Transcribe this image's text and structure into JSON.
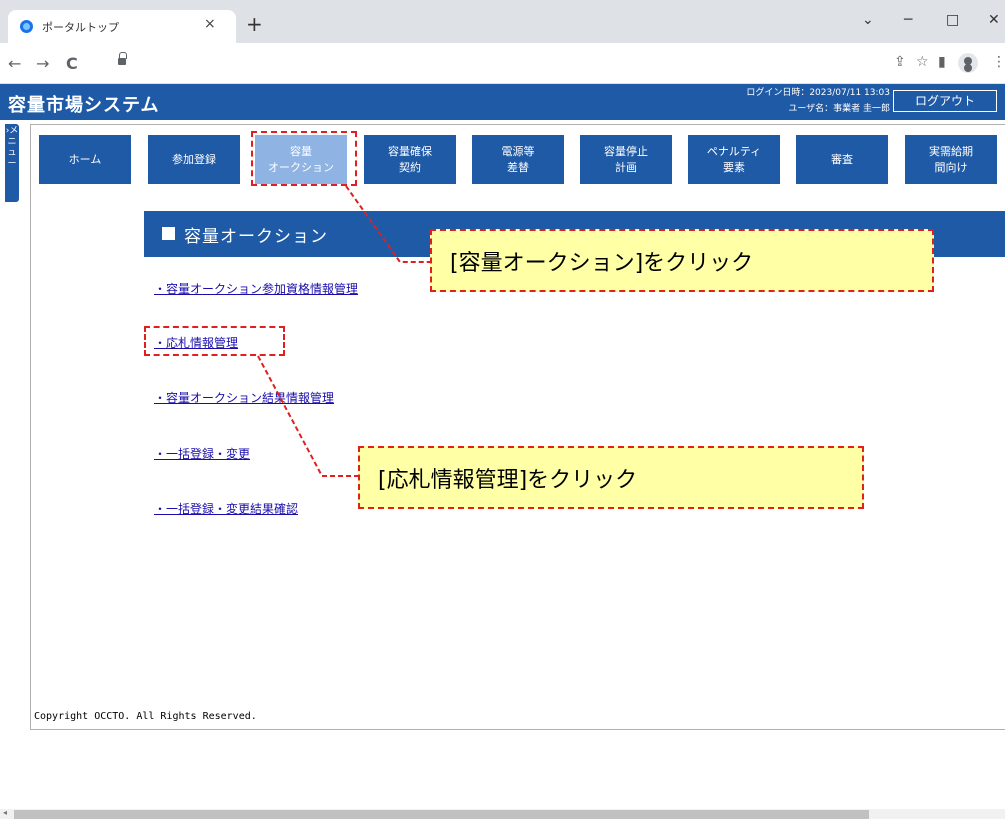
{
  "browser": {
    "tab_title": "ポータルトップ",
    "tab_close": "×",
    "new_tab": "+",
    "minimize": "─",
    "maximize": "□",
    "close": "✕",
    "dropdown": "⌄",
    "back": "←",
    "forward": "→",
    "reload": "C",
    "share": "⇪",
    "bookmark": "☆",
    "panel": "▮",
    "menu": "⋮"
  },
  "header": {
    "title": "容量市場システム",
    "login_time": "ログイン日時：2023/07/11 13:03",
    "user_name": "ユーザ名：事業者 圭一郎",
    "logout_label": "ログアウト"
  },
  "side_tab": {
    "label": "›メニュー"
  },
  "menu": [
    {
      "line1": "ホーム",
      "line2": ""
    },
    {
      "line1": "参加登録",
      "line2": ""
    },
    {
      "line1": "容量",
      "line2": "オークション"
    },
    {
      "line1": "容量確保",
      "line2": "契約"
    },
    {
      "line1": "電源等",
      "line2": "差替"
    },
    {
      "line1": "容量停止",
      "line2": "計画"
    },
    {
      "line1": "ペナルティ",
      "line2": "要素"
    },
    {
      "line1": "審査",
      "line2": ""
    },
    {
      "line1": "実需給期",
      "line2": "間向け"
    }
  ],
  "section": {
    "title": "容量オークション"
  },
  "links": [
    "・容量オークション参加資格情報管理",
    "・応札情報管理",
    "・容量オークション結果情報管理",
    "・一括登録・変更",
    "・一括登録・変更結果確認"
  ],
  "callouts": {
    "first": "[容量オークション]をクリック",
    "second": "[応札情報管理]をクリック"
  },
  "footer": {
    "copyright": "Copyright OCCTO. All Rights Reserved."
  },
  "colors": {
    "brand": "#1f5aa6",
    "active_menu": "#8fb4e3",
    "annotation_red": "#e02020",
    "callout_yellow": "#ffffa6"
  }
}
